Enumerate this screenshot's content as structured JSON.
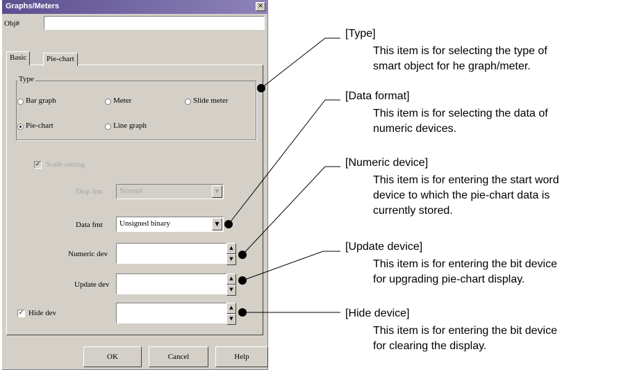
{
  "dialog": {
    "title": "Graphs/Meters",
    "close": "×",
    "object_label": "Obj#",
    "object_value": "",
    "tabs": [
      {
        "label": "Basic"
      },
      {
        "label": "Pie-chart"
      }
    ],
    "type_group": {
      "title": "Type",
      "options": [
        {
          "label": "Bar graph",
          "selected": false
        },
        {
          "label": "Meter",
          "selected": false
        },
        {
          "label": "Slide meter",
          "selected": false
        },
        {
          "label": "Pie-chart",
          "selected": true
        },
        {
          "label": "Line graph",
          "selected": false
        }
      ]
    },
    "scale_check": {
      "label": "Scale setting",
      "checked": true
    },
    "disp_fmt": {
      "label": "Disp fmt",
      "value": "Normal"
    },
    "data_fmt": {
      "label": "Data fmt",
      "value": "Unsigned binary"
    },
    "numeric_dev": {
      "label": "Numeric dev",
      "value": ""
    },
    "update_dev": {
      "label": "Update dev",
      "value": ""
    },
    "hide_dev": {
      "label": "Hide dev",
      "checked": true,
      "value": ""
    },
    "buttons": {
      "ok": "OK",
      "cancel": "Cancel",
      "help": "Help"
    },
    "check_mark": "✓",
    "spin_up": "▲",
    "spin_down": "▼",
    "dropdown": "▼"
  },
  "annotations": [
    {
      "title": "[Type]",
      "desc": "This item is for selecting the type of\nsmart object for he graph/meter."
    },
    {
      "title": "[Data format]",
      "desc": "This item is for selecting the data of\nnumeric devices."
    },
    {
      "title": "[Numeric device]",
      "desc": "This item is for entering the start word\ndevice to which the pie-chart data is\ncurrently stored."
    },
    {
      "title": "[Update device]",
      "desc": "This item is for entering the bit device\nfor upgrading pie-chart display."
    },
    {
      "title": "[Hide device]",
      "desc": "This item is for entering the bit device\nfor clearing the display."
    }
  ]
}
